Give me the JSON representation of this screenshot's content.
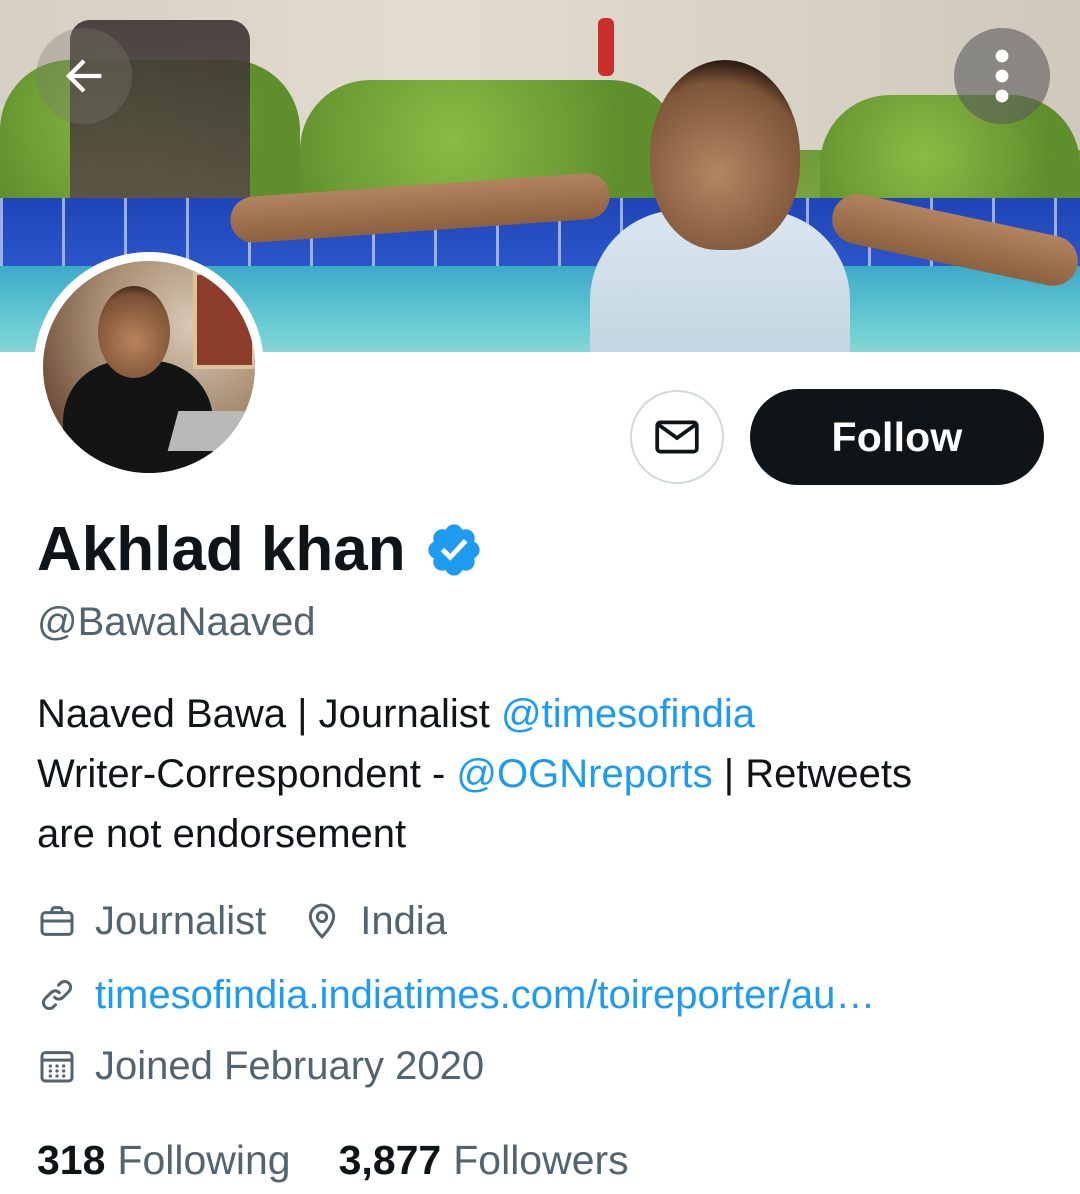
{
  "header": {
    "back_icon": "arrow-left-icon",
    "more_icon": "more-vertical-icon"
  },
  "profile": {
    "name": "Akhlad khan",
    "verified": true,
    "handle": "@BawaNaaved",
    "bio": {
      "line1_text": "Naaved Bawa | Journalist ",
      "line1_mention": "@timesofindia",
      "line2_text": "Writer-Correspondent - ",
      "line2_mention": "@OGNreports",
      "line2_tail": " | Retweets",
      "line3_text": "are not endorsement"
    },
    "category": "Journalist",
    "location": "India",
    "website": "timesofindia.indiatimes.com/toireporter/au…",
    "joined": "Joined February 2020",
    "following_count": "318",
    "following_label": "Following",
    "followers_count": "3,877",
    "followers_label": "Followers"
  },
  "actions": {
    "message_icon": "mail-icon",
    "follow_label": "Follow"
  },
  "colors": {
    "accent": "#1d9bf0",
    "text_primary": "#0f1419",
    "text_secondary": "#536471",
    "follow_bg": "#0f1419"
  }
}
